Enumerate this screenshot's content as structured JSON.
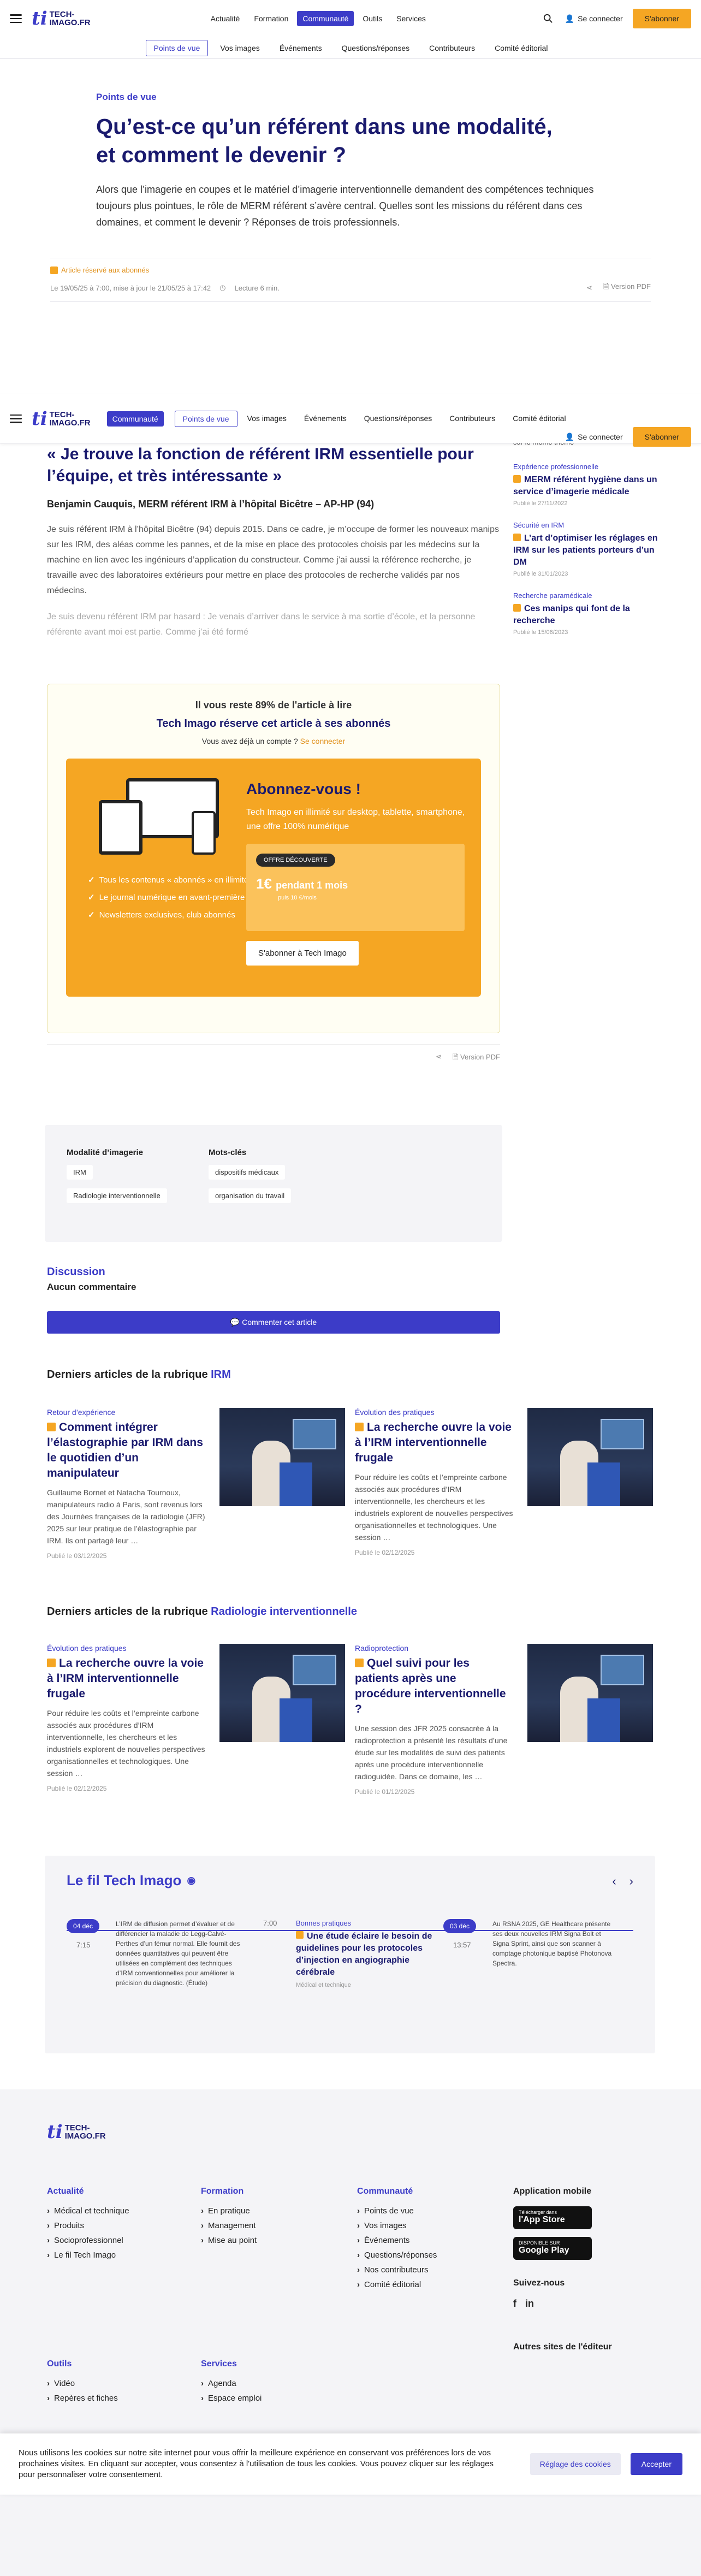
{
  "brand": {
    "ti": "ti",
    "name1": "TECH-",
    "name2": "IMAGO.FR"
  },
  "nav": {
    "items": [
      "Actualité",
      "Formation",
      "Communauté",
      "Outils",
      "Services"
    ],
    "active": 2
  },
  "header": {
    "login": "Se connecter",
    "subscribe": "S'abonner"
  },
  "subnav": {
    "items": [
      "Points de vue",
      "Vos images",
      "Événements",
      "Questions/réponses",
      "Contributeurs",
      "Comité éditorial"
    ],
    "active": 0
  },
  "article": {
    "kicker": "Points de vue",
    "title": "Qu’est-ce qu’un référent dans une modalité, et comment le devenir ?",
    "lead": "Alors que l’imagerie en coupes et le matériel d’imagerie interventionnelle demandent des compétences techniques toujours plus pointues, le rôle de MERM référent s’avère central. Quelles sont les missions du référent dans ces domaines, et comment le devenir ? Réponses de trois professionnels.",
    "badge": "Article réservé aux abonnés",
    "date": "Le 19/05/25 à 7:00, mise à jour le 21/05/25 à 17:42",
    "read": "Lecture 6 min.",
    "pdf": "Version PDF",
    "quote": "« Je trouve la fonction de référent IRM essentielle pour l’équipe, et très intéressante »",
    "author": "Benjamin Cauquis, MERM référent IRM à l’hôpital Bicêtre – AP-HP (94)",
    "p1": "Je suis référent IRM à l’hôpital Bicêtre (94) depuis 2015. Dans ce cadre, je m’occupe de former les nouveaux manips sur les IRM, des aléas comme les pannes, et de la mise en place des protocoles choisis par les médecins sur la machine en lien avec les ingénieurs d’application du constructeur. Comme j’ai aussi la référence recherche, je travaille avec des laboratoires extérieurs pour mettre en place des protocoles de recherche validés par nos médecins.",
    "p2": "Je suis devenu référent IRM par hasard : Je venais d’arriver dans le service à ma sortie d’école, et la personne référente avant moi est partie. Comme j’ai été formé"
  },
  "sidebar": {
    "top": "sur le même thème",
    "items": [
      {
        "cat": "Expérience professionnelle",
        "title": "MERM référent hygiène dans un service d’imagerie médicale",
        "date": "Publié le 27/11/2022"
      },
      {
        "cat": "Sécurité en IRM",
        "title": "L’art d’optimiser les réglages en IRM sur les patients porteurs d’un DM",
        "date": "Publié le 31/01/2023"
      },
      {
        "cat": "Recherche paramédicale",
        "title": "Ces manips qui font de la recherche",
        "date": "Publié le 15/06/2023"
      }
    ]
  },
  "paywall": {
    "rest": "Il vous reste 89% de l'article à lire",
    "reserve": "Tech Imago réserve cet article à ses abonnés",
    "already": "Vous avez déjà un compte ?",
    "login": "Se connecter",
    "list": [
      "Tous les contenus « abonnés » en illimité",
      "Le journal numérique en avant-première",
      "Newsletters exclusives, club abonnés"
    ],
    "title": "Abonnez-vous !",
    "sub": "Tech Imago en illimité sur desktop, tablette, smartphone, une offre 100% numérique",
    "pill": "OFFRE DÉCOUVERTE",
    "price": "1€",
    "period": "pendant 1 mois",
    "then": "puis 10 €/mois",
    "cta": "S'abonner à Tech Imago"
  },
  "tags": {
    "h1": "Modalité d’imagerie",
    "t1": [
      "IRM",
      "Radiologie interventionnelle"
    ],
    "h2": "Mots-clés",
    "t2": [
      "dispositifs médicaux",
      "organisation du travail"
    ]
  },
  "discussion": {
    "title": "Discussion",
    "empty": "Aucun commentaire",
    "cta": "Commenter cet article"
  },
  "latest1": {
    "h": "Derniers articles de la rubrique",
    "cat": "IRM",
    "cards": [
      {
        "cat": "Retour d’expérience",
        "title": "Comment intégrer l’élastographie par IRM dans le quotidien d’un manipulateur",
        "text": "Guillaume Bornet et Natacha Tournoux, manipulateurs radio à Paris, sont revenus lors des Journées françaises de la radiologie (JFR) 2025 sur leur pratique de l’élastographie par IRM. Ils ont partagé leur …",
        "date": "Publié le 03/12/2025"
      },
      {
        "cat": "Évolution des pratiques",
        "title": "La recherche ouvre la voie à l’IRM interventionnelle frugale",
        "text": "Pour réduire les coûts et l’empreinte carbone associés aux procédures d’IRM interventionnelle, les chercheurs et les industriels explorent de nouvelles perspectives organisationnelles et technologiques. Une session …",
        "date": "Publié le 02/12/2025"
      }
    ]
  },
  "latest2": {
    "h": "Derniers articles de la rubrique",
    "cat": "Radiologie interventionnelle",
    "cards": [
      {
        "cat": "Évolution des pratiques",
        "title": "La recherche ouvre la voie à l’IRM interventionnelle frugale",
        "text": "Pour réduire les coûts et l’empreinte carbone associés aux procédures d’IRM interventionnelle, les chercheurs et les industriels explorent de nouvelles perspectives organisationnelles et technologiques. Une session …",
        "date": "Publié le 02/12/2025"
      },
      {
        "cat": "Radioprotection",
        "title": "Quel suivi pour les patients après une procédure interventionnelle ?",
        "text": "Une session des JFR 2025 consacrée à la radioprotection a présenté les résultats d’une étude sur les modalités de suivi des patients après une procédure interventionnelle radioguidée. Dans ce domaine, les …",
        "date": "Publié le 01/12/2025"
      }
    ]
  },
  "fil": {
    "title": "Le fil Tech Imago",
    "items": [
      {
        "date": "04 déc",
        "time": "7:15",
        "text": "L’IRM de diffusion permet d’évaluer et de différencier la maladie de Legg-Calvé-Perthes d’un fémur normal. Elle fournit des données quantitatives qui peuvent être utilisées en complément des techniques d’IRM conventionnelles pour améliorer la précision du diagnostic. (Étude)"
      },
      {
        "date": "",
        "time": "7:00",
        "cat": "Bonnes pratiques",
        "title": "Une étude éclaire le besoin de guidelines pour les protocoles d’injection en angiographie cérébrale",
        "sub": "Médical et technique"
      },
      {
        "date": "03 déc",
        "time": "13:57",
        "text": "Au RSNA 2025, GE Healthcare présente ses deux nouvelles IRM Signa Bolt et Signa Sprint, ainsi que son scanner à comptage photonique baptisé Photonova Spectra."
      }
    ]
  },
  "footer": {
    "c1": {
      "h": "Actualité",
      "items": [
        "Médical et technique",
        "Produits",
        "Socioprofessionnel",
        "Le fil Tech Imago"
      ]
    },
    "c2": {
      "h": "Formation",
      "items": [
        "En pratique",
        "Management",
        "Mise au point"
      ]
    },
    "c3": {
      "h": "Communauté",
      "items": [
        "Points de vue",
        "Vos images",
        "Événements",
        "Questions/réponses",
        "Nos contributeurs",
        "Comité éditorial"
      ]
    },
    "c4": {
      "h": "Outils",
      "items": [
        "Vidéo",
        "Repères et fiches"
      ]
    },
    "c5": {
      "h": "Services",
      "items": [
        "Agenda",
        "Espace emploi"
      ]
    },
    "app": "Application mobile",
    "appstore1": "Télécharger dans",
    "appstore2": "l'App Store",
    "gplay1": "DISPONIBLE SUR",
    "gplay2": "Google Play",
    "follow": "Suivez-nous",
    "other": "Autres sites de l'éditeur"
  },
  "cookie": {
    "text": "Nous utilisons les cookies sur notre site internet pour vous offrir la meilleure expérience en conservant vos préférences lors de vos prochaines visites. En cliquant sur accepter, vous consentez à l'utilisation de tous les cookies. Vous pouvez cliquer sur les réglages pour personnaliser votre consentement.",
    "prefs": "Réglage des cookies",
    "accept": "Accepter"
  }
}
